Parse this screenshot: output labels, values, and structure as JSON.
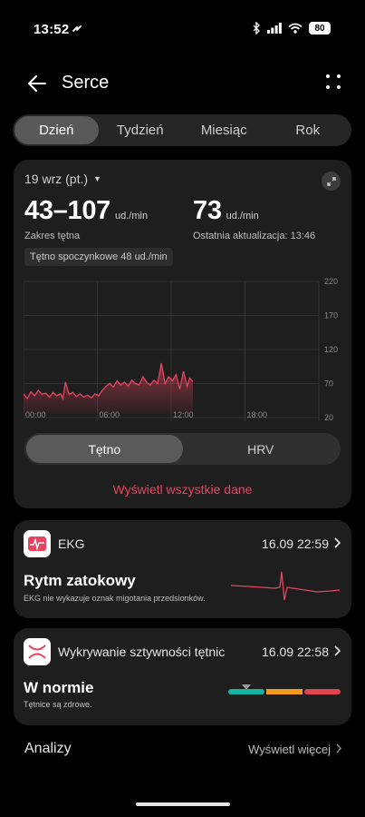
{
  "status_bar": {
    "time": "13:52",
    "battery": "80"
  },
  "header": {
    "title": "Serce"
  },
  "period_tabs": [
    {
      "label": "Dzień",
      "active": true
    },
    {
      "label": "Tydzień",
      "active": false
    },
    {
      "label": "Miesiąc",
      "active": false
    },
    {
      "label": "Rok",
      "active": false
    }
  ],
  "summary": {
    "date": "19 wrz (pt.)",
    "range_value": "43–107",
    "range_unit": "ud./min",
    "range_label": "Zakres tętna",
    "latest_value": "73",
    "latest_unit": "ud./min",
    "latest_label": "Ostatnia aktualizacja: 13:46",
    "resting": "Tętno spoczynkowe 48 ud./min"
  },
  "chart_data": {
    "type": "area",
    "x_tick_labels": [
      "00:00",
      "06:00",
      "12:00",
      "18:00"
    ],
    "y_tick_labels": [
      "220",
      "170",
      "120",
      "70",
      "20"
    ],
    "ylim": [
      20,
      220
    ],
    "xlim": [
      0,
      24
    ],
    "x": [
      0,
      0.3,
      0.6,
      0.9,
      1.2,
      1.5,
      1.8,
      2.1,
      2.4,
      2.7,
      3.0,
      3.2,
      3.4,
      3.7,
      4.0,
      4.3,
      4.6,
      4.9,
      5.2,
      5.5,
      5.8,
      6.1,
      6.4,
      6.7,
      7.0,
      7.3,
      7.6,
      7.9,
      8.2,
      8.5,
      8.8,
      9.1,
      9.4,
      9.7,
      10.0,
      10.3,
      10.6,
      10.9,
      11.2,
      11.5,
      11.8,
      12.1,
      12.4,
      12.7,
      13.0,
      13.3,
      13.5,
      13.77
    ],
    "values": [
      55,
      48,
      58,
      52,
      60,
      54,
      56,
      50,
      57,
      52,
      55,
      48,
      72,
      54,
      57,
      51,
      55,
      50,
      53,
      49,
      55,
      52,
      60,
      66,
      70,
      65,
      74,
      68,
      72,
      66,
      75,
      70,
      68,
      80,
      72,
      68,
      75,
      70,
      100,
      70,
      80,
      74,
      83,
      62,
      88,
      66,
      78,
      73
    ],
    "color": "#e8435f",
    "grid": true
  },
  "metric_toggle": [
    {
      "label": "Tętno",
      "active": true
    },
    {
      "label": "HRV",
      "active": false
    }
  ],
  "view_all_label": "Wyświetl wszystkie dane",
  "ekg": {
    "title": "EKG",
    "time": "16.09 22:59",
    "result": "Rytm zatokowy",
    "description": "EKG nie wykazuje oznak migotania przedsionków."
  },
  "artery": {
    "title": "Wykrywanie sztywności tętnic",
    "time": "16.09 22:58",
    "result": "W normie",
    "description": "Tętnice są zdrowe.",
    "scale_colors": [
      "#17b3a3",
      "#f29a1c",
      "#e2454f"
    ]
  },
  "analyses": {
    "title": "Analizy",
    "more_label": "Wyświetl więcej"
  },
  "colors": {
    "accent": "#e8435f",
    "card": "#1e1e1e"
  }
}
